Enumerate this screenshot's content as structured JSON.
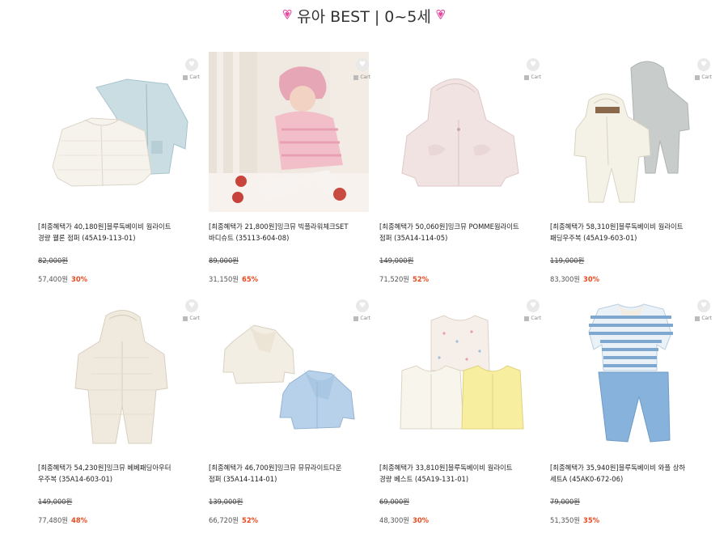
{
  "header": {
    "title": "유아 BEST | 0~5세",
    "heart_color": "#e6439d"
  },
  "ui": {
    "cart_label": "Cart",
    "discount_color": "#e8491f"
  },
  "products": [
    {
      "name_line1": "[최종혜택가 40,180원]블루독베이비 웜라이트",
      "name_line2": "경량 웰론 점퍼 (45A19-113-01)",
      "original_price": "82,000원",
      "sale_price": "57,400원",
      "discount": "30%",
      "image": "light-down-jacket-set"
    },
    {
      "name_line1": "[최종혜택가 21,800원]밍크뮤 빅플라워체크SET",
      "name_line2": "바디슈트 (35113-604-08)",
      "original_price": "89,000원",
      "sale_price": "31,150원",
      "discount": "65%",
      "image": "baby-pink-check-outfit-photo"
    },
    {
      "name_line1": "[최종혜택가 50,060원]밍크뮤 POMME웜라이트",
      "name_line2": "점퍼 (35A14-114-05)",
      "original_price": "149,000원",
      "sale_price": "71,520원",
      "discount": "52%",
      "image": "quilted-hooded-jacket"
    },
    {
      "name_line1": "[최종혜택가 58,310원]블루독베이비 웜라이트",
      "name_line2": "패딩우주복 (45A19-603-01)",
      "original_price": "119,000원",
      "sale_price": "83,300원",
      "discount": "30%",
      "image": "padded-bodysuit-set"
    },
    {
      "name_line1": "[최종혜택가 54,230원]밍크뮤 베베패딩아우터",
      "name_line2": "우주복 (35A14-603-01)",
      "original_price": "149,000원",
      "sale_price": "77,480원",
      "discount": "48%",
      "image": "quilted-hooded-romper"
    },
    {
      "name_line1": "[최종혜택가 46,700원]밍크뮤 뮤뮤라이트다운",
      "name_line2": "점퍼 (35A14-114-01)",
      "original_price": "139,000원",
      "sale_price": "66,720원",
      "discount": "52%",
      "image": "scarf-down-jackets"
    },
    {
      "name_line1": "[최종혜택가 33,810원]블루독베이비 웜라이트",
      "name_line2": "경량 베스트 (45A19-131-01)",
      "original_price": "69,000원",
      "sale_price": "48,300원",
      "discount": "30%",
      "image": "light-vests-set"
    },
    {
      "name_line1": "[최종혜택가 35,940원]블루독베이비 와플 상하",
      "name_line2": "세트A (45AK0-672-06)",
      "original_price": "79,000원",
      "sale_price": "51,350원",
      "discount": "35%",
      "image": "striped-top-pants-set"
    }
  ]
}
